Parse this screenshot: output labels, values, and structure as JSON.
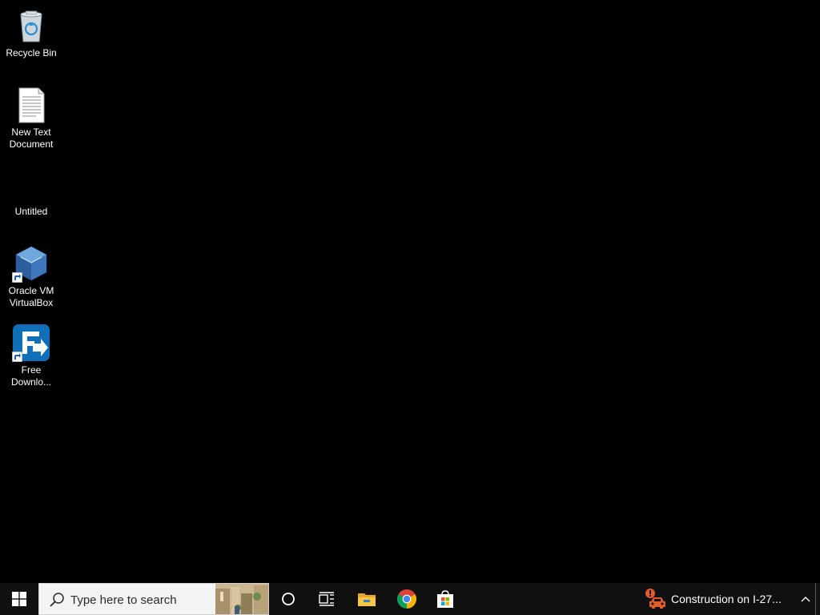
{
  "desktop": {
    "icons": [
      {
        "label": "Recycle Bin",
        "icon": "recycle-bin-icon"
      },
      {
        "label": "New Text\nDocument",
        "icon": "text-document-icon"
      },
      {
        "label": "Untitled",
        "icon": "untitled-icon"
      },
      {
        "label": "Oracle VM\nVirtualBox",
        "icon": "virtualbox-icon"
      },
      {
        "label": "Free\nDownlo...",
        "icon": "free-download-manager-icon"
      }
    ]
  },
  "taskbar": {
    "search_placeholder": "Type here to search",
    "notification_text": "Construction on I-27...",
    "pinned": [
      {
        "icon": "cortana-icon"
      },
      {
        "icon": "task-view-icon"
      },
      {
        "icon": "file-explorer-icon"
      },
      {
        "icon": "chrome-icon"
      },
      {
        "icon": "microsoft-store-icon"
      }
    ]
  },
  "colors": {
    "desktop_bg": "#000000",
    "taskbar_bg": "#101010",
    "search_bg": "#f3f3f3",
    "traffic_alert": "#e05a2b"
  }
}
